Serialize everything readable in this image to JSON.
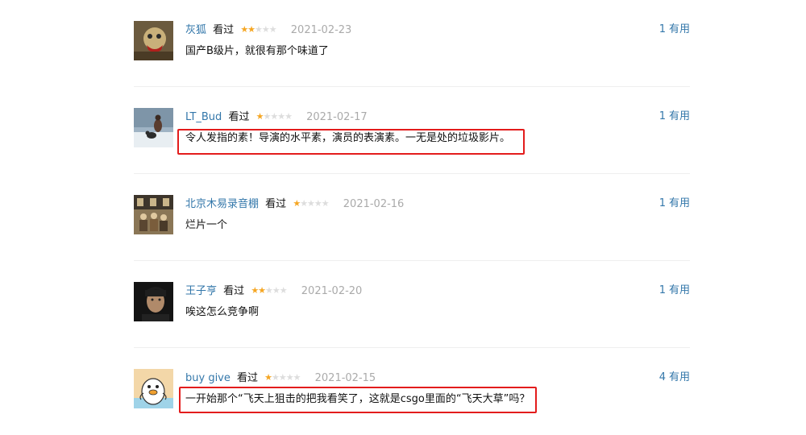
{
  "colors": {
    "link": "#3377aa",
    "star_on": "#f5a623",
    "star_off": "#dddddd",
    "date": "#aaaaaa",
    "highlight": "#e31c1c"
  },
  "reviews": [
    {
      "author": "灰狐",
      "status": "看过",
      "rating": 2,
      "stars_on": "★★",
      "stars_off": "★★★",
      "date": "2021-02-23",
      "votes": "1",
      "vote_label": "有用",
      "content": "国产B级片，就很有那个味道了",
      "highlighted": false,
      "avatar_icon": "masked-figure-avatar"
    },
    {
      "author": "LT_Bud",
      "status": "看过",
      "rating": 1,
      "stars_on": "★",
      "stars_off": "★★★★",
      "date": "2021-02-17",
      "votes": "1",
      "vote_label": "有用",
      "content": "令人发指的素！导演的水平素，演员的表演素。一无是处的垃圾影片。",
      "highlighted": true,
      "avatar_icon": "snow-dog-avatar"
    },
    {
      "author": "北京木易录音棚",
      "status": "看过",
      "rating": 1,
      "stars_on": "★",
      "stars_off": "★★★★",
      "date": "2021-02-16",
      "votes": "1",
      "vote_label": "有用",
      "content": "烂片一个",
      "highlighted": false,
      "avatar_icon": "band-photo-avatar"
    },
    {
      "author": "王子亨",
      "status": "看过",
      "rating": 2,
      "stars_on": "★★",
      "stars_off": "★★★",
      "date": "2021-02-20",
      "votes": "1",
      "vote_label": "有用",
      "content": "唉这怎么竞争啊",
      "highlighted": false,
      "avatar_icon": "portrait-avatar"
    },
    {
      "author": "buy give",
      "status": "看过",
      "rating": 1,
      "stars_on": "★",
      "stars_off": "★★★★",
      "date": "2021-02-15",
      "votes": "4",
      "vote_label": "有用",
      "content": "一开始那个“飞天上狙击的把我看笑了，这就是csgo里面的“飞天大草”吗？",
      "highlighted": true,
      "avatar_icon": "cartoon-penguin-avatar"
    }
  ]
}
